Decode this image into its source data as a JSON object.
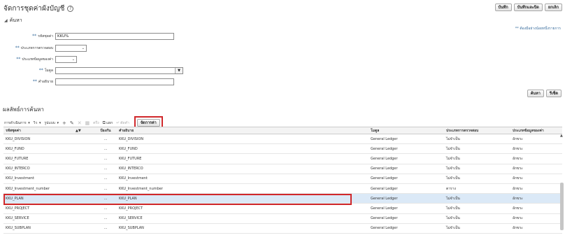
{
  "header": {
    "title": "จัดการชุดค่าผังบัญชี",
    "buttons": [
      "บันทึก",
      "บันทึกและปิด",
      "ยกเลิก"
    ]
  },
  "search": {
    "section_label": "ค้นหา",
    "required_note": "** ต้องมีอย่างน้อยหนึ่งรายการ",
    "fields": [
      {
        "label": "รหัสชุดค่า",
        "value": "KKU%"
      },
      {
        "label": "ประเภทการตรวจสอบ",
        "value": ""
      },
      {
        "label": "ประเภทข้อมูลของค่า",
        "value": ""
      },
      {
        "label": "โมดูล",
        "value": ""
      },
      {
        "label": "คำอธิบาย",
        "value": ""
      }
    ],
    "buttons": [
      "ค้นหา",
      "รีเซ็ต"
    ]
  },
  "results": {
    "title": "ผลลัพธ์การค้นหา",
    "toolbar": {
      "actions": "การดำเนินการ",
      "view": "วิว",
      "format": "รูปแบบ",
      "freeze": "ตรึง",
      "detach": "แยก",
      "wrap": "ตัดคำ",
      "manage_values": "จัดการค่า"
    },
    "columns": [
      "รหัสชุดค่า",
      "",
      "ป้องกัน",
      "คำอธิบาย",
      "โมดูล",
      "ประเภทการตรวจสอบ",
      "ประเภทข้อมูลของค่า"
    ],
    "rows": [
      {
        "code": "KKU_DIVISION",
        "protect": "...",
        "desc": "KKU_DIVISION",
        "module": "General Ledger",
        "validation": "ไม่จำเป็น",
        "datatype": "อักขระ"
      },
      {
        "code": "KKU_FUND",
        "protect": "...",
        "desc": "KKU_FUND",
        "module": "General Ledger",
        "validation": "ไม่จำเป็น",
        "datatype": "อักขระ"
      },
      {
        "code": "KKU_FUTURE",
        "protect": "...",
        "desc": "KKU_FUTURE",
        "module": "General Ledger",
        "validation": "ไม่จำเป็น",
        "datatype": "อักขระ"
      },
      {
        "code": "KKU_INTERCO",
        "protect": "...",
        "desc": "KKU_INTERCO",
        "module": "General Ledger",
        "validation": "ไม่จำเป็น",
        "datatype": "อักขระ"
      },
      {
        "code": "KKU_Investment",
        "protect": "...",
        "desc": "KKU_Investment",
        "module": "General Ledger",
        "validation": "ไม่จำเป็น",
        "datatype": "อักขระ"
      },
      {
        "code": "KKU_Investment_number",
        "protect": "...",
        "desc": "KKU_Investment_number",
        "module": "General Ledger",
        "validation": "ตาราง",
        "datatype": "อักขระ"
      },
      {
        "code": "KKU_PLAN",
        "protect": "...",
        "desc": "KKU_PLAN",
        "module": "General Ledger",
        "validation": "ไม่จำเป็น",
        "datatype": "อักขระ"
      },
      {
        "code": "KKU_PROJECT",
        "protect": "...",
        "desc": "KKU_PROJECT",
        "module": "General Ledger",
        "validation": "ไม่จำเป็น",
        "datatype": "อักขระ"
      },
      {
        "code": "KKU_SERVICE",
        "protect": "...",
        "desc": "KKU_SERVICE",
        "module": "General Ledger",
        "validation": "ไม่จำเป็น",
        "datatype": "อักขระ"
      },
      {
        "code": "KKU_SUBPLAN",
        "protect": "...",
        "desc": "KKU_SUBPLAN",
        "module": "General Ledger",
        "validation": "ไม่จำเป็น",
        "datatype": "อักขระ"
      }
    ],
    "selected_index": 6
  },
  "colors": {
    "highlight": "#d0282b",
    "selected_row": "#dbe9f7",
    "required": "#3a6e9e"
  }
}
